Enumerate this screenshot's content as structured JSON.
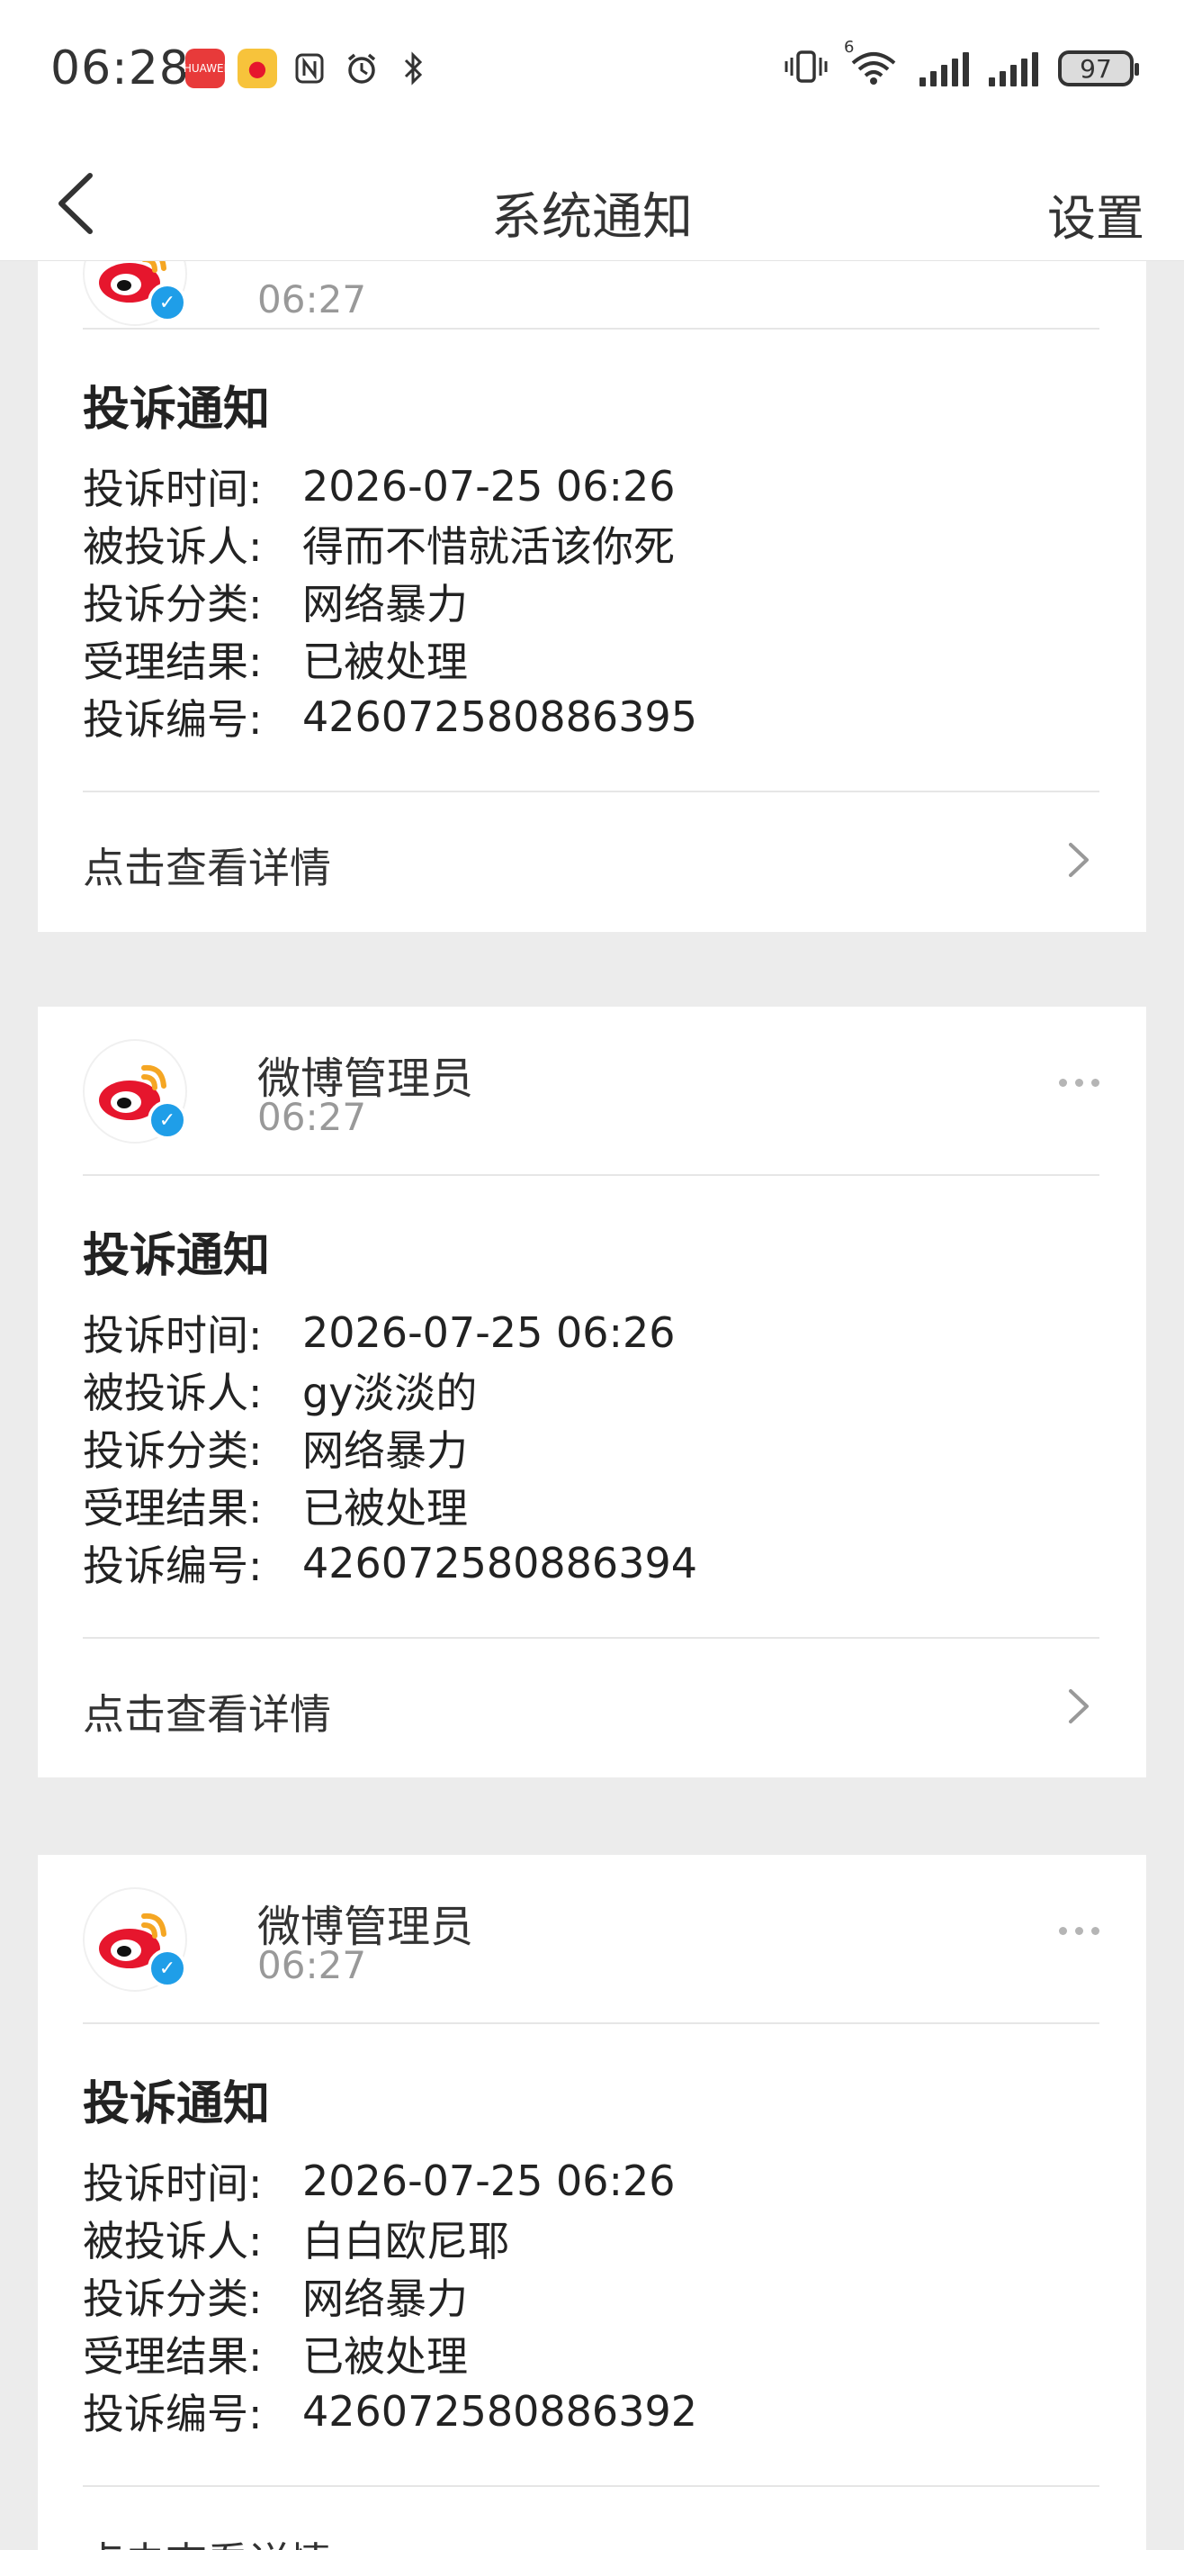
{
  "status_bar": {
    "time": "06:28",
    "app_icons": [
      "huawei-appgallery-icon",
      "weibo-icon",
      "nfc-icon",
      "alarm-icon",
      "bluetooth-icon"
    ],
    "app_label": "HUAWEI",
    "network": "6",
    "battery": "97"
  },
  "nav": {
    "title": "系统通知",
    "settings": "设置"
  },
  "cards": [
    {
      "sender": "",
      "time": "06:27",
      "title": "投诉通知",
      "rows": [
        {
          "label": "投诉时间:",
          "value": "2026-07-25 06:26"
        },
        {
          "label": "被投诉人:",
          "value": "得而不惜就活该你死"
        },
        {
          "label": "投诉分类:",
          "value": "网络暴力"
        },
        {
          "label": "受理结果:",
          "value": "已被处理"
        },
        {
          "label": "投诉编号:",
          "value": "426072580886395"
        }
      ],
      "detail": "点击查看详情"
    },
    {
      "sender": "微博管理员",
      "time": "06:27",
      "title": "投诉通知",
      "rows": [
        {
          "label": "投诉时间:",
          "value": "2026-07-25 06:26"
        },
        {
          "label": "被投诉人:",
          "value": "gy淡淡的"
        },
        {
          "label": "投诉分类:",
          "value": "网络暴力"
        },
        {
          "label": "受理结果:",
          "value": "已被处理"
        },
        {
          "label": "投诉编号:",
          "value": "426072580886394"
        }
      ],
      "detail": "点击查看详情"
    },
    {
      "sender": "微博管理员",
      "time": "06:27",
      "title": "投诉通知",
      "rows": [
        {
          "label": "投诉时间:",
          "value": "2026-07-25 06:26"
        },
        {
          "label": "被投诉人:",
          "value": "白白欧尼耶"
        },
        {
          "label": "投诉分类:",
          "value": "网络暴力"
        },
        {
          "label": "受理结果:",
          "value": "已被处理"
        },
        {
          "label": "投诉编号:",
          "value": "426072580886392"
        }
      ],
      "detail": "点击查看详情"
    }
  ],
  "colors": {
    "background": "#ececec",
    "card": "#ffffff",
    "verified_badge": "#1f9ee8",
    "weibo_red": "#e6162d",
    "weibo_orange": "#f5a623"
  }
}
